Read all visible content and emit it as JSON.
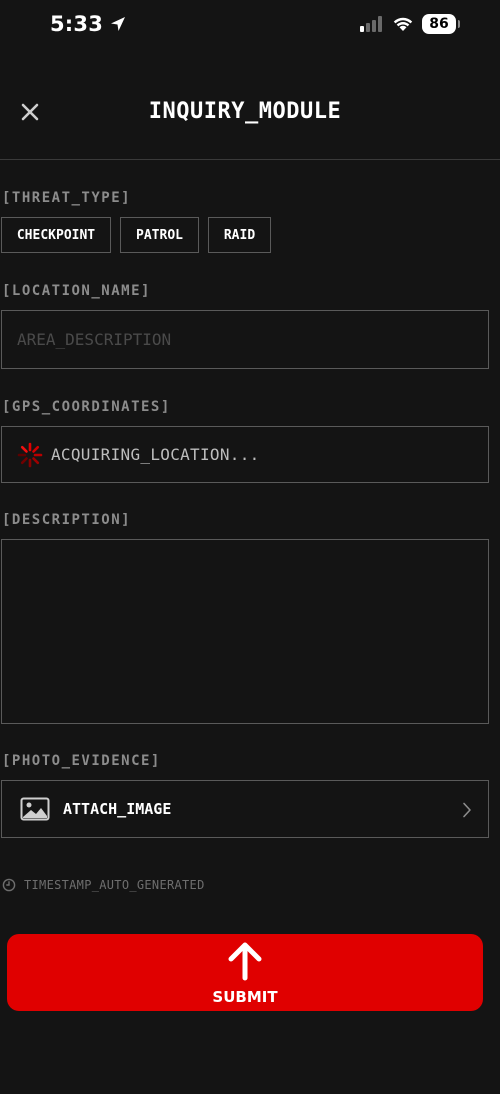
{
  "status_bar": {
    "time": "5:33",
    "battery": "86"
  },
  "header": {
    "title": "INQUIRY_MODULE"
  },
  "threat_type": {
    "label": "[THREAT_TYPE]",
    "options": [
      "CHECKPOINT",
      "PATROL",
      "RAID"
    ]
  },
  "location_name": {
    "label": "[LOCATION_NAME]",
    "placeholder": "AREA_DESCRIPTION",
    "value": ""
  },
  "gps_coordinates": {
    "label": "[GPS_COORDINATES]",
    "status_text": "ACQUIRING_LOCATION..."
  },
  "description": {
    "label": "[DESCRIPTION]",
    "value": ""
  },
  "photo_evidence": {
    "label": "[PHOTO_EVIDENCE]",
    "button_label": "ATTACH_IMAGE"
  },
  "timestamp_note": "TIMESTAMP_AUTO_GENERATED",
  "submit": {
    "label": "SUBMIT"
  },
  "colors": {
    "accent": "#e00000",
    "background": "#141414",
    "border": "#5a5a5a"
  }
}
